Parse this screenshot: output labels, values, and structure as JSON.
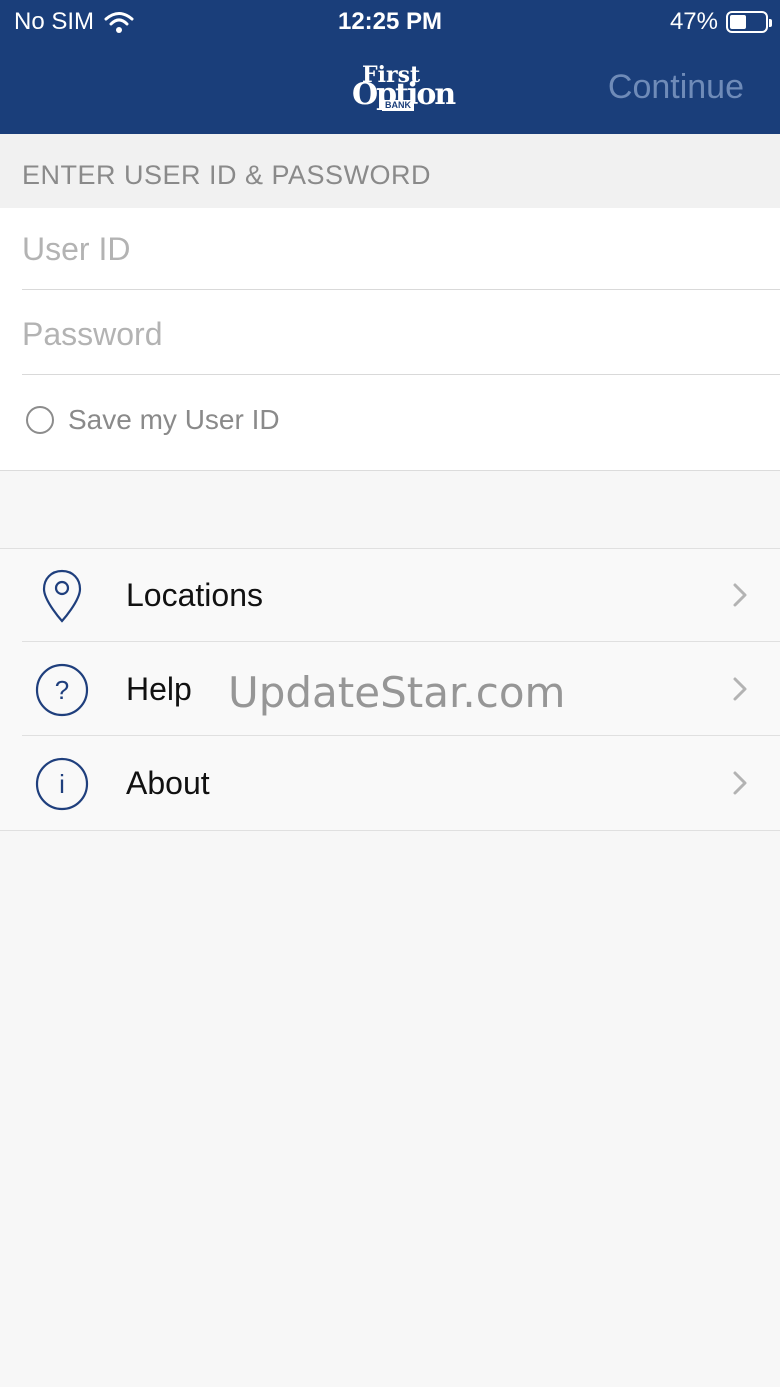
{
  "status_bar": {
    "carrier": "No SIM",
    "time": "12:25 PM",
    "battery_percent": "47%",
    "battery_level": 0.47
  },
  "navbar": {
    "logo_top": "First",
    "logo_main": "Option",
    "logo_bank": "BANK",
    "continue_label": "Continue"
  },
  "login": {
    "section_header": "ENTER USER ID & PASSWORD",
    "user_id_placeholder": "User ID",
    "user_id_value": "",
    "password_placeholder": "Password",
    "password_value": "",
    "save_user_id_label": "Save my User ID",
    "save_user_id_checked": false
  },
  "menu": {
    "items": [
      {
        "label": "Locations",
        "icon": "location-pin-icon"
      },
      {
        "label": "Help",
        "icon": "question-circle-icon"
      },
      {
        "label": "About",
        "icon": "info-circle-icon"
      }
    ]
  },
  "watermark": "UpdateStar.com",
  "colors": {
    "brand_blue": "#1a3e7a",
    "continue_text": "#6f8bb8",
    "icon_blue": "#1f3f7d"
  }
}
